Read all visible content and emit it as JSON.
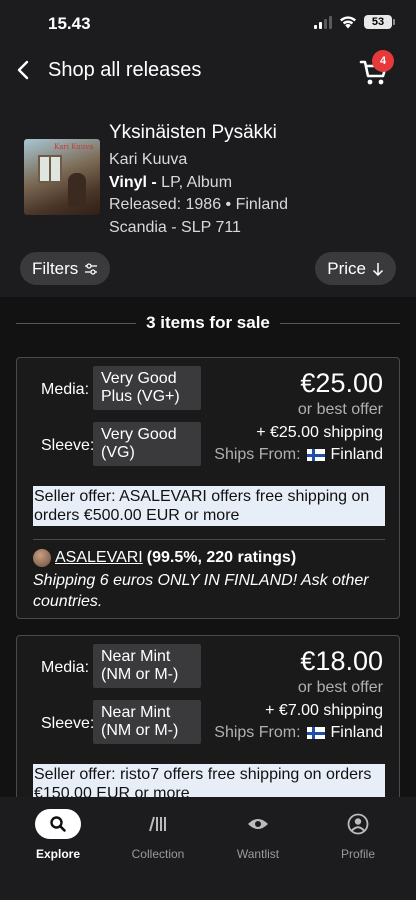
{
  "status_bar": {
    "time": "15.43",
    "battery": "53"
  },
  "nav": {
    "title": "Shop all releases",
    "cart_count": "4"
  },
  "release": {
    "title": "Yksinäisten Pysäkki",
    "artist": "Kari Kuuva",
    "format_bold": "Vinyl -",
    "format_rest": " LP, Album",
    "released": "Released: 1986 • Finland",
    "label": "Scandia - SLP 711",
    "cover_text": "Kari Kuuva"
  },
  "filters": {
    "filters_label": "Filters",
    "price_label": "Price"
  },
  "listing_count": "3 items for sale",
  "listings": [
    {
      "media_label": "Media:",
      "media_grade": "Very Good Plus (VG+)",
      "sleeve_label": "Sleeve:",
      "sleeve_grade": "Very Good (VG)",
      "price": "€25.00",
      "offer": "or best offer",
      "shipping": "+ €25.00 shipping",
      "ships_from_label": "Ships From:",
      "ships_from": "Finland",
      "seller_offer": "Seller offer: ASALEVARI offers free shipping on orders €500.00 EUR or more",
      "seller_name": "ASALEVARI",
      "seller_rating": "(99.5%, 220 ratings)",
      "seller_comment": "Shipping 6 euros ONLY IN FINLAND! Ask other countries."
    },
    {
      "media_label": "Media:",
      "media_grade": "Near Mint (NM or M-)",
      "sleeve_label": "Sleeve:",
      "sleeve_grade": "Near Mint (NM or M-)",
      "price": "€18.00",
      "offer": "or best offer",
      "shipping": "+ €7.00 shipping",
      "ships_from_label": "Ships From:",
      "ships_from": "Finland",
      "seller_offer": "Seller offer: risto7 offers free shipping on orders €150.00 EUR or more"
    }
  ],
  "tabs": [
    {
      "label": "Explore",
      "icon": "search-icon"
    },
    {
      "label": "Collection",
      "icon": "collection-icon"
    },
    {
      "label": "Wantlist",
      "icon": "eye-icon"
    },
    {
      "label": "Profile",
      "icon": "profile-icon"
    }
  ],
  "colors": {
    "background": "#1c1c1e",
    "list_background": "#121212",
    "badge": "#e5393c",
    "seller_offer_bg": "#e8eef8"
  }
}
